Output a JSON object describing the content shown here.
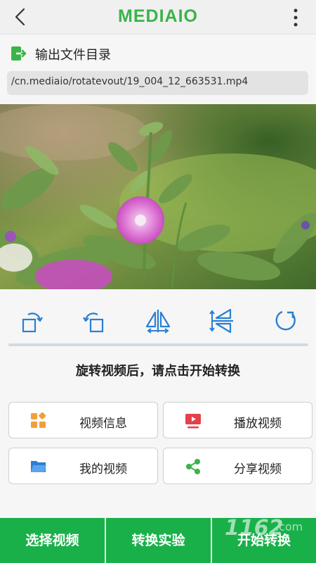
{
  "header": {
    "title": "MEDIAIO"
  },
  "output": {
    "label": "输出文件目录",
    "path": "/cn.mediaio/rotatevout/19_004_12_663531.mp4"
  },
  "tools": [
    {
      "icon": "rotate-left-icon"
    },
    {
      "icon": "rotate-right-icon"
    },
    {
      "icon": "flip-horizontal-icon"
    },
    {
      "icon": "flip-vertical-icon"
    },
    {
      "icon": "reset-rotation-icon"
    }
  ],
  "hint": "旋转视频后，请点击开始转换",
  "actions": {
    "video_info": "视频信息",
    "play_video": "播放视频",
    "my_videos": "我的视频",
    "share_video": "分享视频"
  },
  "bottom": {
    "select": "选择视频",
    "convert_lab": "转换实验",
    "start": "开始转换"
  },
  "colors": {
    "brand": "#3cb34a",
    "tool_blue": "#2a7fd4",
    "bottom_bar": "#19b04a",
    "info_orange": "#f0a03a",
    "play_red": "#e5414a",
    "folder_blue": "#2a7fd4",
    "share_green": "#3cb34a"
  },
  "watermark": "1162.com"
}
